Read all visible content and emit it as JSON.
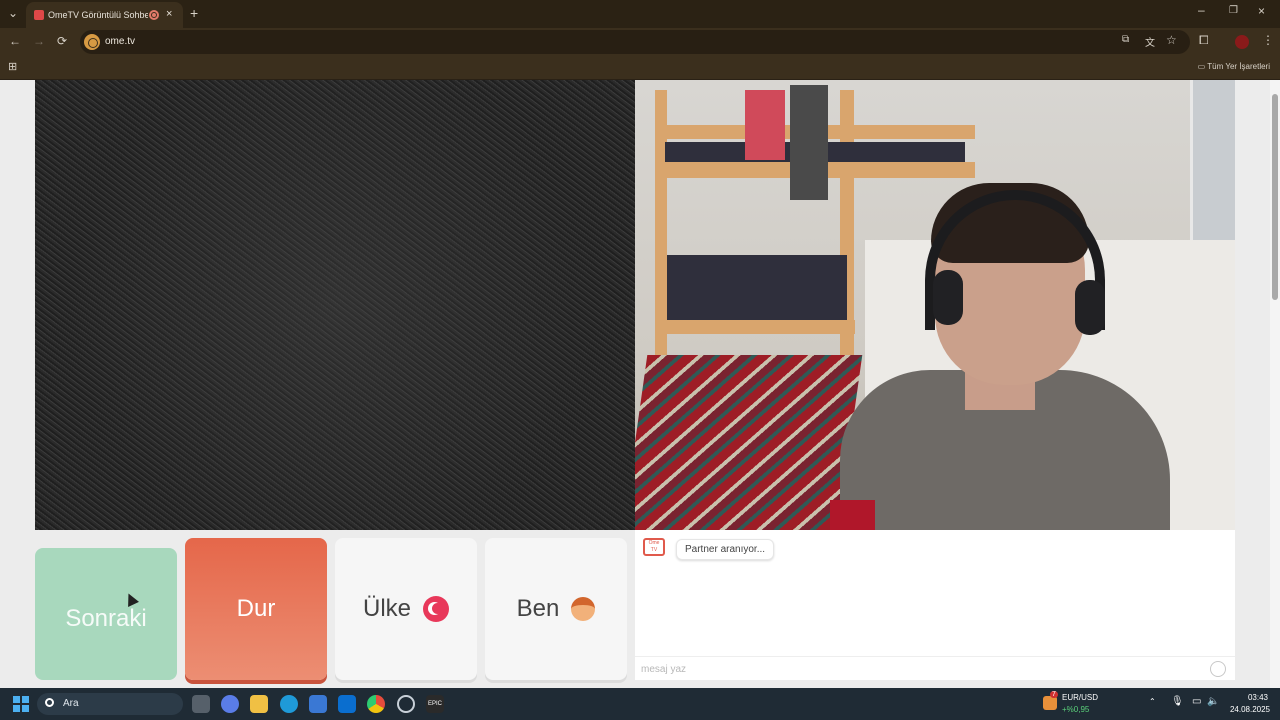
{
  "browser": {
    "tab_title": "OmeTV Görüntülü Sohbet",
    "url": "ome.tv",
    "bookmarks_label": "Tüm Yer İşaretleri",
    "new_tab_symbol": "+",
    "close_symbol": "×",
    "tab_menu_symbol": "⌄",
    "back_symbol": "←",
    "forward_symbol": "→",
    "reload_symbol": "⟳"
  },
  "actions": {
    "next_label": "Sonraki",
    "stop_label": "Dur",
    "country_label": "Ülke",
    "me_label": "Ben"
  },
  "chat": {
    "logo_text": "Ome TV",
    "status_message": "Partner aranıyor...",
    "input_placeholder": "mesaj yaz"
  },
  "taskbar": {
    "search_label": "Ara",
    "widget_pair": "EUR/USD",
    "widget_change": "+%0,95",
    "widget_badge": "7",
    "time": "03:43",
    "date": "24.08.2025"
  },
  "colors": {
    "next_button": "#a8d8bd",
    "stop_button": "#e5674a",
    "browser_frame": "#3b2f1d",
    "taskbar": "#1f2b35"
  }
}
